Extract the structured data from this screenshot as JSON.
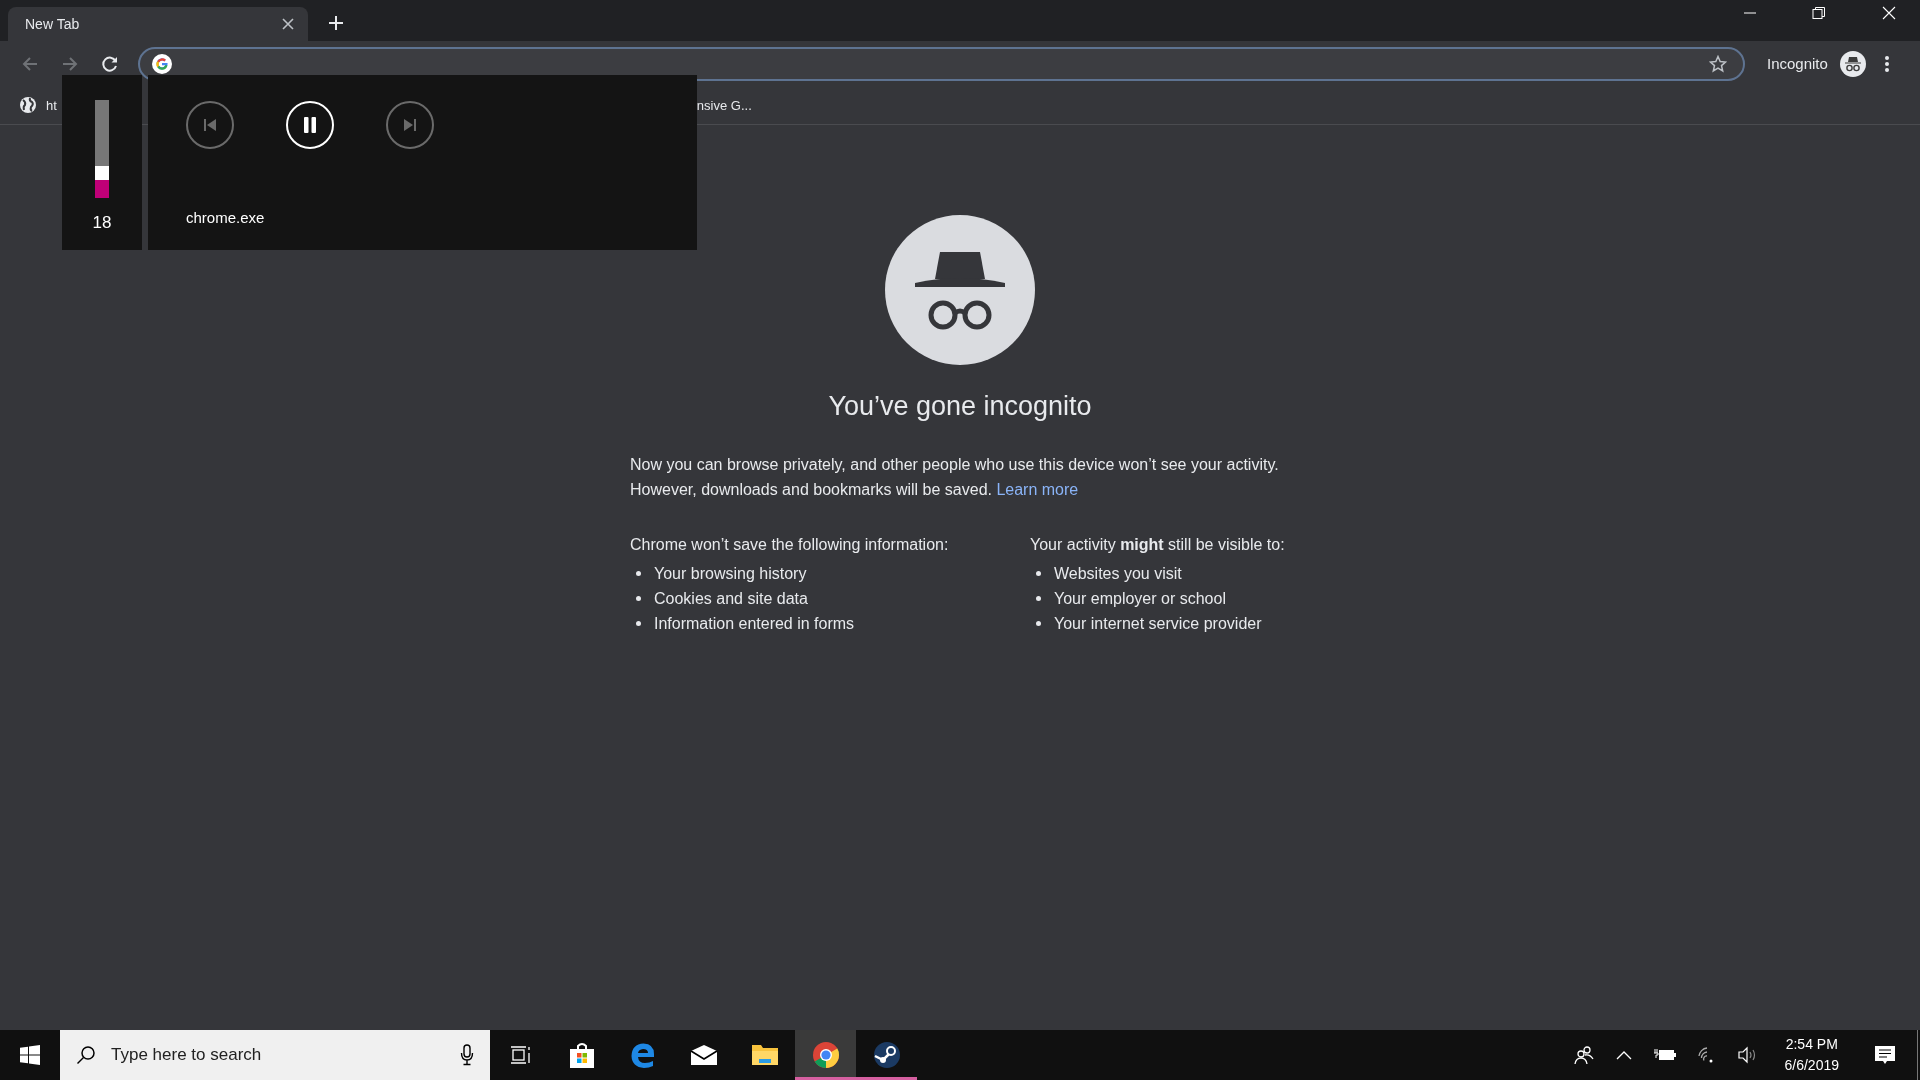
{
  "tabs": [
    {
      "title": "New Tab",
      "selected": true
    }
  ],
  "profile": {
    "label": "Incognito"
  },
  "bookmarks": [
    {
      "text": "ht"
    },
    {
      "text": "nsive G..."
    }
  ],
  "media_overlay": {
    "level": 0.18,
    "volume_reading": "18",
    "app": "chrome.exe",
    "controls": [
      {
        "kind": "previous",
        "disabled": true
      },
      {
        "kind": "pause",
        "disabled": false
      },
      {
        "kind": "next",
        "disabled": true
      }
    ]
  },
  "page": {
    "title": "You’ve gone incognito",
    "intro": "Now you can browse privately, and other people who use this device won’t see your activity. However, downloads and bookmarks will be saved.",
    "link": "Learn more",
    "columns": [
      {
        "heading": "Chrome won’t save the following information:",
        "items": [
          "Your browsing history",
          "Cookies and site data",
          "Information entered in forms"
        ]
      },
      {
        "heading": "Your activity **might** still be visible to:",
        "items": [
          "Websites you visit",
          "Your employer or school",
          "Your internet service provider"
        ]
      }
    ]
  },
  "taskbar": {
    "search_placeholder": "Type here to search",
    "apps": [
      {
        "kind": "store",
        "running": false,
        "active": false
      },
      {
        "kind": "edge",
        "running": false,
        "active": false
      },
      {
        "kind": "mail",
        "running": false,
        "active": false
      },
      {
        "kind": "files",
        "running": false,
        "active": false
      },
      {
        "kind": "chrome",
        "running": true,
        "active": true
      },
      {
        "kind": "steam",
        "running": true,
        "active": false
      }
    ],
    "time": "2:54 PM",
    "date": "6/6/2019"
  }
}
